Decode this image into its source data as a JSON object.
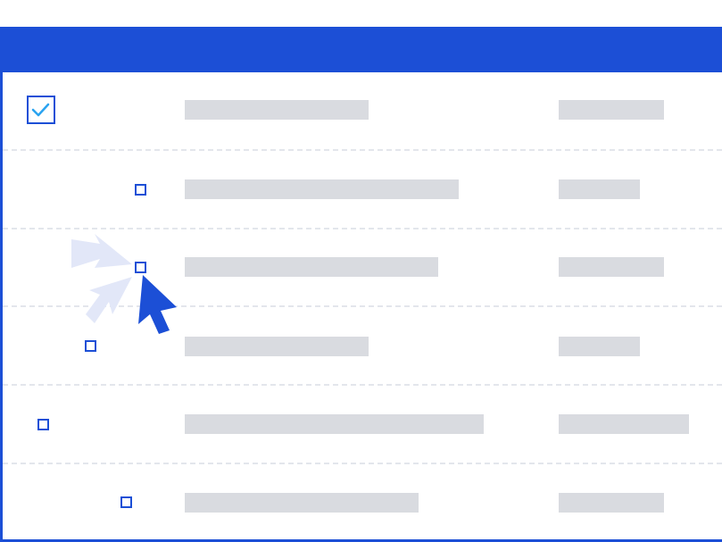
{
  "rows": [
    {
      "checked": true
    },
    {
      "checked": false
    },
    {
      "checked": false,
      "hovered": true
    },
    {
      "checked": false
    },
    {
      "checked": false
    },
    {
      "checked": false
    }
  ],
  "colors": {
    "accent": "#1c4fd6",
    "check_mark": "#2aa3f0",
    "placeholder_bar": "#d9dbe0",
    "divider": "#e3e6ec",
    "click_burst": "#e2e7f8"
  },
  "icons": {
    "checkbox_checked": "check-mark-icon",
    "pointer": "mouse-pointer-icon",
    "click_effect": "click-burst-icon"
  }
}
